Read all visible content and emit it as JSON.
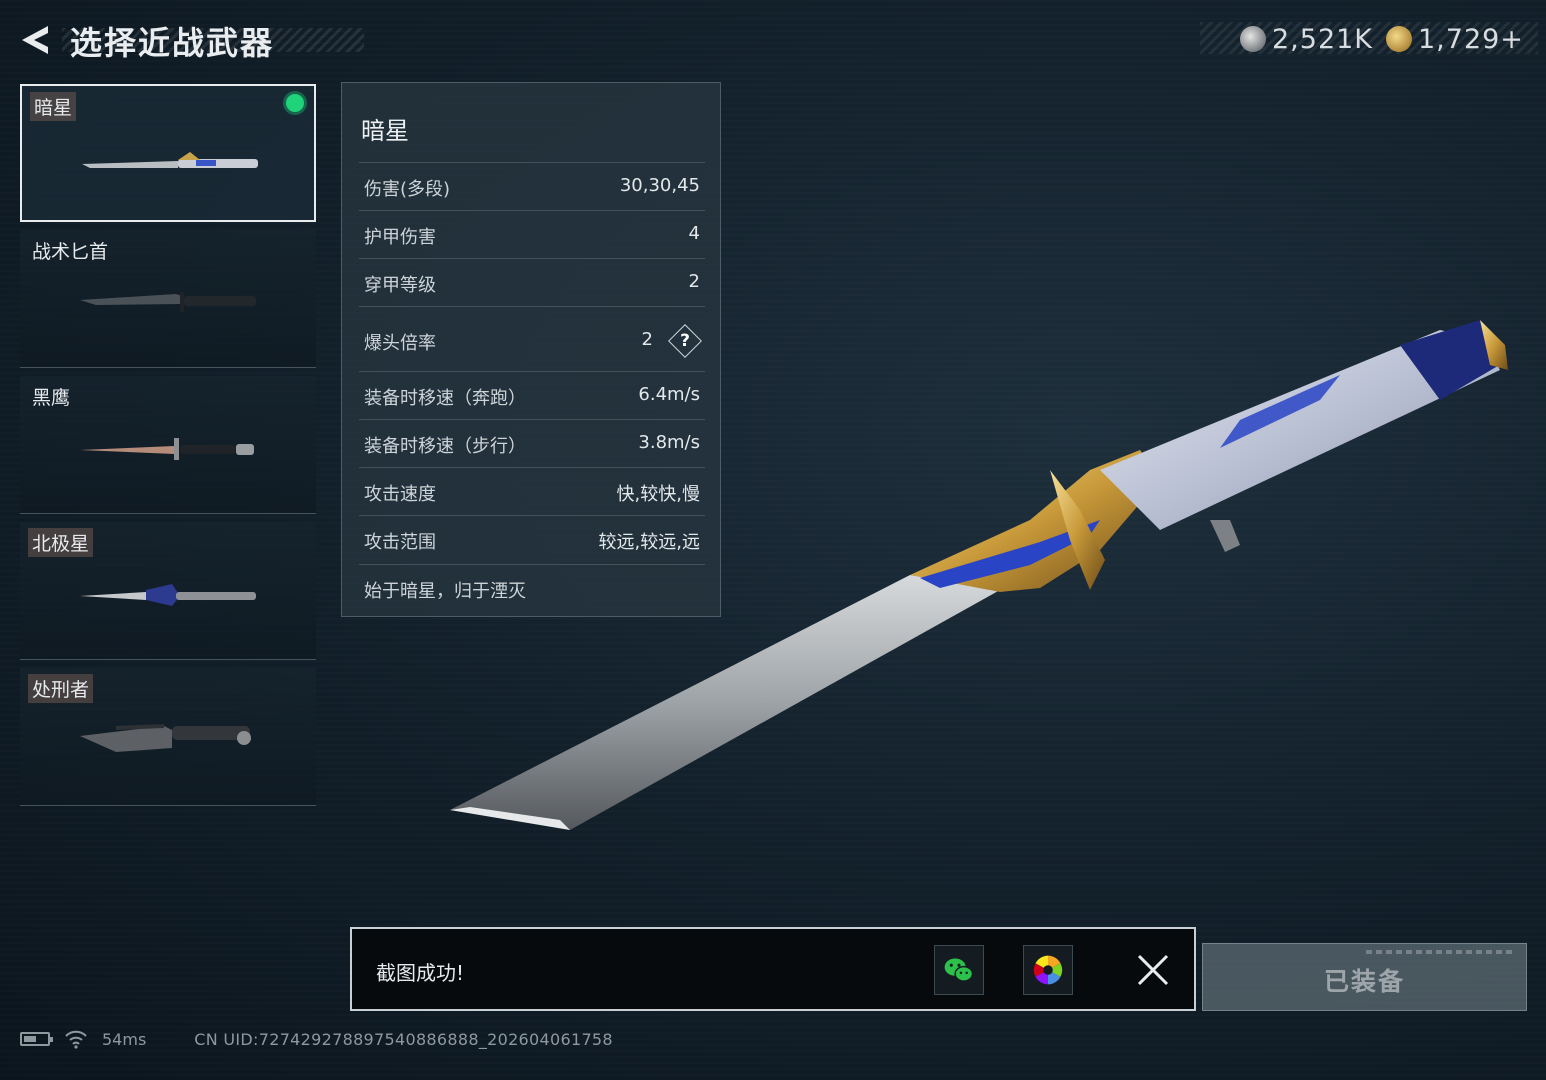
{
  "header": {
    "title": "选择近战武器",
    "currencies": [
      {
        "icon": "silver-coin-icon",
        "amount": "2,521K"
      },
      {
        "icon": "gold-triangle-coin-icon",
        "amount": "1,729+"
      }
    ]
  },
  "weapons": [
    {
      "name": "暗星",
      "selected": true,
      "equipped": true
    },
    {
      "name": "战术匕首",
      "selected": false,
      "equipped": false
    },
    {
      "name": "黑鹰",
      "selected": false,
      "equipped": false
    },
    {
      "name": "北极星",
      "selected": false,
      "equipped": false
    },
    {
      "name": "处刑者",
      "selected": false,
      "equipped": false
    }
  ],
  "stats": {
    "title": "暗星",
    "rows": [
      {
        "label": "伤害(多段)",
        "value": "30,30,45"
      },
      {
        "label": "护甲伤害",
        "value": "4"
      },
      {
        "label": "穿甲等级",
        "value": "2"
      },
      {
        "label": "爆头倍率",
        "value": "2"
      },
      {
        "label": "装备时移速（奔跑）",
        "value": "6.4m/s"
      },
      {
        "label": "装备时移速（步行）",
        "value": "3.8m/s"
      },
      {
        "label": "攻击速度",
        "value": "快,较快,慢"
      },
      {
        "label": "攻击范围",
        "value": "较远,较远,远"
      }
    ],
    "flavor": "始于暗星，归于湮灭"
  },
  "toast": {
    "message": "截图成功!"
  },
  "equip_button": {
    "label": "已装备"
  },
  "status_bar": {
    "ping": "54ms",
    "uid": "CN UID:727429278897540886888_202604061758"
  },
  "colors": {
    "accent_green": "#1ed37a",
    "background": "#13212c",
    "panel": "#26343e"
  }
}
